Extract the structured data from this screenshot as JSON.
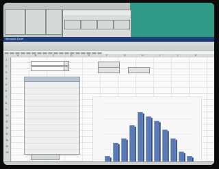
{
  "top_tiles": [
    "",
    "",
    "",
    "",
    "",
    "",
    "",
    ""
  ],
  "dialog_title": "",
  "excel": {
    "title": "Microsoft Excel",
    "menu": [
      "",
      "",
      "",
      "",
      "",
      "",
      "",
      "",
      ""
    ]
  },
  "columns": [
    "A",
    "B",
    "C",
    "D",
    "E",
    "F",
    "G",
    "H",
    "I",
    "J",
    "K"
  ],
  "rows": [
    "1",
    "2",
    "3",
    "4",
    "5",
    "6",
    "7",
    "8",
    "9",
    "10",
    "11",
    "12",
    "13",
    "14",
    "15",
    "16"
  ],
  "left_panel": {
    "label": "",
    "list_header": "",
    "button": ""
  },
  "chart_buttons": [
    "",
    "",
    ""
  ],
  "chart_data": {
    "type": "bar",
    "categories": [
      "1",
      "2",
      "3",
      "4",
      "5",
      "6",
      "7",
      "8",
      "9",
      "10",
      "11"
    ],
    "values": [
      2,
      5,
      6,
      9,
      12,
      11,
      10,
      8,
      6,
      3,
      2
    ],
    "ylim": [
      0,
      14
    ],
    "grid": true,
    "bar_color": "#5a79b7"
  },
  "status": ""
}
